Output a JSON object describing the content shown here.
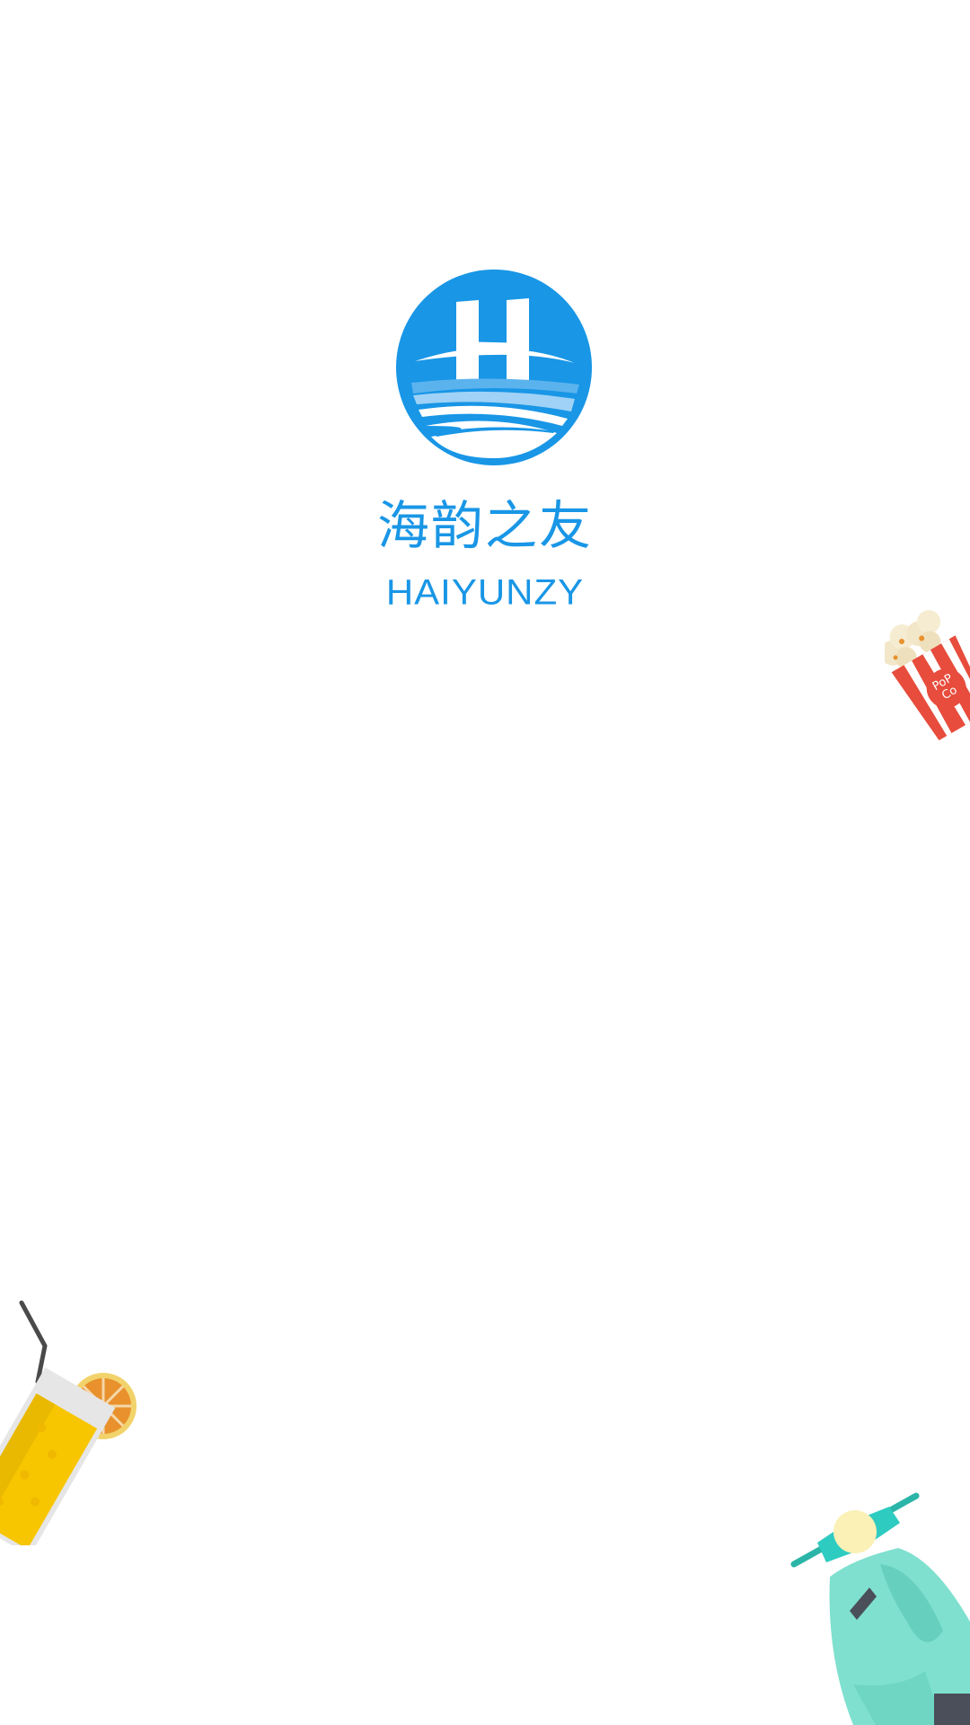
{
  "splash": {
    "brand_name_cn": "海韵之友",
    "brand_name_en": "HAIYUNZY",
    "logo_letter": "H"
  },
  "colors": {
    "background": "#ffffff",
    "brand_blue": "#1996e6",
    "popcorn_red": "#e74c3c",
    "juice_yellow": "#f7c600",
    "lemon_orange": "#e8912d",
    "scooter_teal": "#7fe0cf",
    "scooter_accent": "#2ecbc1"
  },
  "icons": {
    "logo": "haiyun-logo-icon",
    "popcorn": "popcorn-illustration",
    "juice": "juice-glass-illustration",
    "scooter": "scooter-illustration"
  }
}
